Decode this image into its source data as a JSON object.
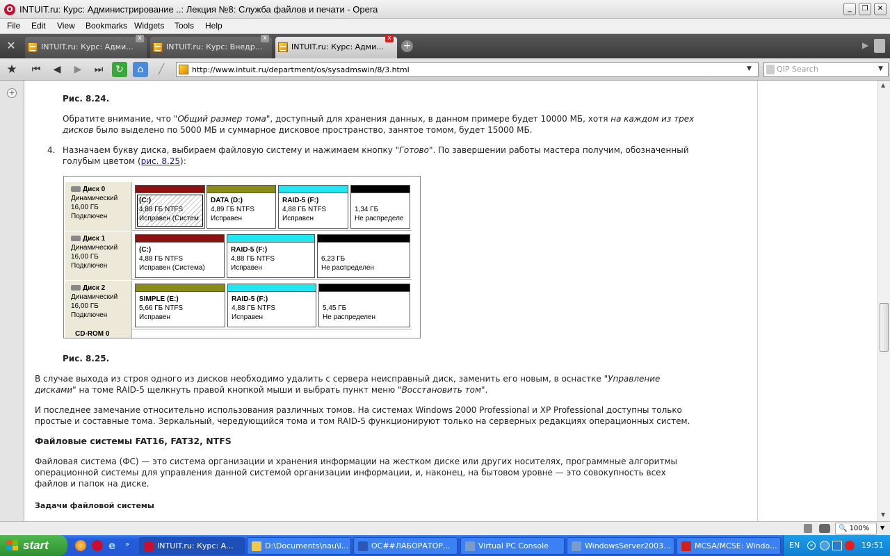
{
  "window": {
    "title": "INTUIT.ru: Курс: Администрирование ..: Лекция №8: Служба файлов и печати - Opera",
    "icon": "opera-icon"
  },
  "menu": [
    "File",
    "Edit",
    "View",
    "Bookmarks",
    "Widgets",
    "Tools",
    "Help"
  ],
  "tabs": [
    {
      "label": "INTUIT.ru: Курс: Адми...",
      "active": false
    },
    {
      "label": "INTUIT.ru: Курс: Внедр...",
      "active": false
    },
    {
      "label": "INTUIT.ru: Курс: Адми...",
      "active": true
    }
  ],
  "address": {
    "url": "http://www.intuit.ru/department/os/sysadmswin/8/3.html"
  },
  "search": {
    "placeholder": "QIP Search"
  },
  "article": {
    "fig1_caption": "Рис. 8.24.",
    "para1_a": "Обратите внимание, что \"",
    "para1_b": "Общий размер тома",
    "para1_c": "\", доступный для хранения данных, в данном примере будет 10000 МБ, хотя ",
    "para1_d": "на каждом из трех",
    "para1_e": "дисков",
    "para1_f": " было выделено по 5000 МБ и суммарное дисковое пространство, занятое томом, будет 15000 МБ.",
    "step_num": "4.",
    "step_a": "Назначаем букву диска, выбираем файловую систему и нажимаем кнопку \"",
    "step_b": "Готово",
    "step_c": "\". По завершении работы мастера получим, обозначенный",
    "step_d": "голубым цветом (",
    "step_link": "рис. 8.25",
    "step_e": "):",
    "fig2_caption": "Рис. 8.25.",
    "para2_a": "В случае выхода из строя одного из дисков необходимо удалить с сервера неисправный диск, заменить его новым, в оснастке \"",
    "para2_b": "Управление",
    "para2_c": "дисками",
    "para2_d": "\" на томе RAID-5 щелкнуть правой кнопкой мыши и выбрать пункт меню \"",
    "para2_e": "Восстановить том",
    "para2_f": "\".",
    "para3_l1": "И последнее замечание относительно использования различных томов. На системах Windows 2000 Professional и XP Professional доступны только",
    "para3_l2": "простые и составные тома. Зеркальный, чередующийся тома и том RAID-5 функционируют только на серверных редакциях операционных систем.",
    "heading": "Файловые системы FAT16, FAT32, NTFS",
    "para4_l1": "Файловая система (ФС) — это система организации и хранения информации на жестком диске или других носителях, программные алгоритмы",
    "para4_l2": "операционной системы для управления данной системой организации информации, и, наконец, на бытовом уровне — это совокупность всех",
    "para4_l3": "файлов и папок на диске.",
    "subheading": "Задачи файловой системы"
  },
  "disks": [
    {
      "name": "Диск 0",
      "type": "Динамический",
      "size": "16,00 ГБ",
      "status": "Подключен",
      "parts": [
        {
          "name": "(C:)",
          "size": "4,88 ГБ NTFS",
          "state": "Исправен (Систем",
          "color": "#8b1010",
          "selected": true
        },
        {
          "name": "DATA  (D:)",
          "size": "4,89 ГБ NTFS",
          "state": "Исправен",
          "color": "#8b8b1a"
        },
        {
          "name": "RAID-5  (F:)",
          "size": "4,88 ГБ NTFS",
          "state": "Исправен",
          "color": "#22e6f0"
        },
        {
          "name": "",
          "size": "1,34 ГБ",
          "state": "Не распределе",
          "color": "#000000"
        }
      ]
    },
    {
      "name": "Диск 1",
      "type": "Динамический",
      "size": "16,00 ГБ",
      "status": "Подключен",
      "parts": [
        {
          "name": "(C:)",
          "size": "4,88 ГБ NTFS",
          "state": "Исправен (Система)",
          "color": "#8b1010"
        },
        {
          "name": "RAID-5  (F:)",
          "size": "4,88 ГБ NTFS",
          "state": "Исправен",
          "color": "#22e6f0"
        },
        {
          "name": "",
          "size": "6,23 ГБ",
          "state": "Не распределен",
          "color": "#000000"
        }
      ]
    },
    {
      "name": "Диск 2",
      "type": "Динамический",
      "size": "16,00 ГБ",
      "status": "Подключен",
      "parts": [
        {
          "name": "SIMPLE  (E:)",
          "size": "5,66 ГБ NTFS",
          "state": "Исправен",
          "color": "#8b8b1a"
        },
        {
          "name": "RAID-5  (F:)",
          "size": "4,88 ГБ NTFS",
          "state": "Исправен",
          "color": "#22e6f0"
        },
        {
          "name": "",
          "size": "5,45 ГБ",
          "state": "Не распределен",
          "color": "#000000"
        }
      ]
    }
  ],
  "cdrom_label": "CD-ROM 0",
  "statusbar": {
    "zoom": "100%"
  },
  "taskbar": {
    "start": "start",
    "tasks": [
      {
        "label": "INTUIT.ru: Курс: А...",
        "icon": "opera-icon",
        "color": "#c8102e",
        "active": true
      },
      {
        "label": "D:\\Documents\\nau\\l...",
        "icon": "folder-icon",
        "color": "#f0c850"
      },
      {
        "label": "ОС##ЛАБОРАТОР...",
        "icon": "word-icon",
        "color": "#2b58b8"
      },
      {
        "label": "Virtual PC Console",
        "icon": "virtualpc-icon",
        "color": "#7a9ccc"
      },
      {
        "label": "WindowsServer2003...",
        "icon": "virtualpc-icon",
        "color": "#7a9ccc"
      },
      {
        "label": "MCSA/MCSE: Windo...",
        "icon": "pdf-icon",
        "color": "#d02020"
      }
    ],
    "lang": "EN",
    "clock": "19:51"
  }
}
